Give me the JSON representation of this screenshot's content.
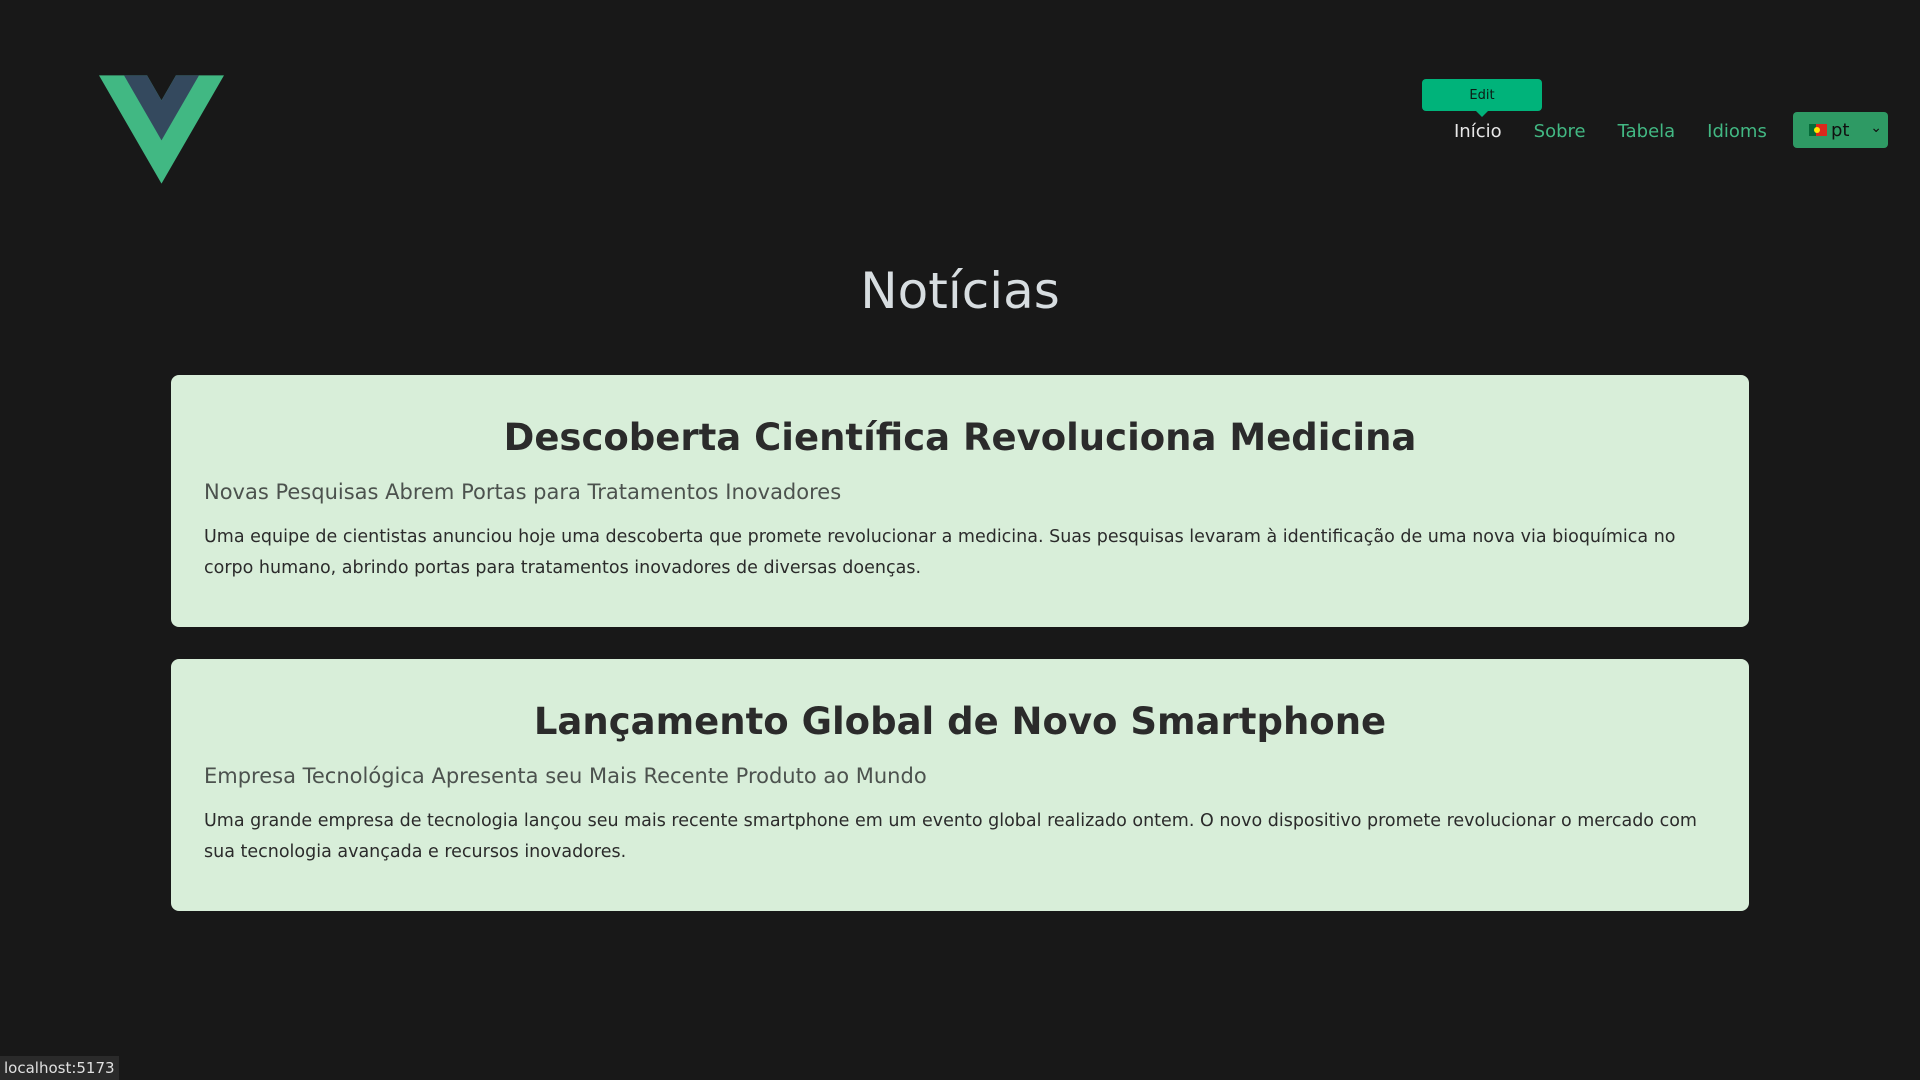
{
  "header": {
    "logo_icon": "vue-logo-icon",
    "tooltip": "Edit",
    "nav": [
      {
        "label": "Início",
        "active": true
      },
      {
        "label": "Sobre",
        "active": false
      },
      {
        "label": "Tabela",
        "active": false
      },
      {
        "label": "Idioms",
        "active": false
      }
    ],
    "language": {
      "flag_icon": "portugal-flag-icon",
      "value": "pt"
    }
  },
  "main": {
    "title": "Notícias",
    "articles": [
      {
        "title": "Descoberta Científica Revoluciona Medicina",
        "subtitle": "Novas Pesquisas Abrem Portas para Tratamentos Inovadores",
        "body": "Uma equipe de cientistas anunciou hoje uma descoberta que promete revolucionar a medicina. Suas pesquisas levaram à identificação de uma nova via bioquímica no corpo humano, abrindo portas para tratamentos inovadores de diversas doenças."
      },
      {
        "title": "Lançamento Global de Novo Smartphone",
        "subtitle": "Empresa Tecnológica Apresenta seu Mais Recente Produto ao Mundo",
        "body": "Uma grande empresa de tecnologia lançou seu mais recente smartphone em um evento global realizado ontem. O novo dispositivo promete revolucionar o mercado com sua tecnologia avançada e recursos inovadores."
      }
    ]
  },
  "status_bar": {
    "url": "localhost:5173"
  },
  "colors": {
    "background": "#181818",
    "accent": "#42b883",
    "card": "#d8eed9",
    "tooltip": "#00b37a"
  }
}
